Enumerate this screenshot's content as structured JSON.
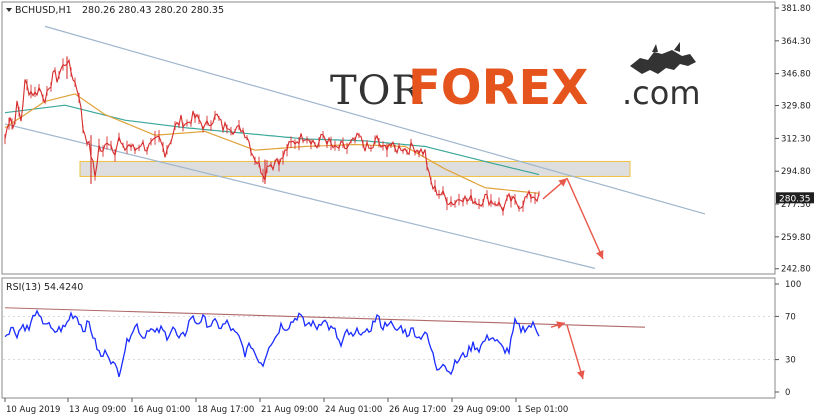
{
  "header": {
    "symbol": "BCHUSD,H1",
    "ohlc": "280.26 280.43 280.20 280.35"
  },
  "logo": {
    "prefix": "TOR",
    "main": "FOREX",
    "suffix": ".com"
  },
  "colors": {
    "candle": "#d62c2c",
    "ma_fast": "#e0a23a",
    "ma_slow": "#3aa79a",
    "channel": "#9fb6cc",
    "zone_fill": "#d8d8d8",
    "zone_border": "#f0c040",
    "arrow": "#e8584a",
    "rsi": "#1a2cff",
    "rsi_trend": "#b06a6a",
    "logo_dark": "#333333",
    "logo_accent": "#e6541e"
  },
  "chart_data": [
    {
      "type": "line",
      "title": "",
      "current_price_label": "280.35",
      "price_ticks": [
        "381.80",
        "364.30",
        "346.80",
        "329.80",
        "312.30",
        "294.80",
        "277.30",
        "259.80",
        "242.80"
      ],
      "price_tick_values": [
        381.8,
        364.3,
        346.8,
        329.8,
        312.3,
        294.8,
        277.3,
        259.8,
        242.8
      ],
      "ylim": [
        240,
        385
      ],
      "x_labels": [
        "10 Aug 2019",
        "13 Aug 09:00",
        "16 Aug 01:00",
        "18 Aug 17:00",
        "21 Aug 09:00",
        "24 Aug 01:00",
        "26 Aug 17:00",
        "29 Aug 09:00",
        "1 Sep 01:00"
      ],
      "x_label_index": [
        0,
        63,
        127,
        191,
        255,
        319,
        383,
        447,
        511
      ],
      "close_series": [
        {
          "i": 0,
          "v": 312
        },
        {
          "i": 5,
          "v": 325
        },
        {
          "i": 8,
          "v": 318
        },
        {
          "i": 12,
          "v": 330
        },
        {
          "i": 16,
          "v": 322
        },
        {
          "i": 20,
          "v": 342
        },
        {
          "i": 24,
          "v": 338
        },
        {
          "i": 30,
          "v": 336
        },
        {
          "i": 34,
          "v": 339
        },
        {
          "i": 40,
          "v": 334
        },
        {
          "i": 44,
          "v": 336
        },
        {
          "i": 48,
          "v": 348
        },
        {
          "i": 52,
          "v": 344
        },
        {
          "i": 56,
          "v": 349
        },
        {
          "i": 62,
          "v": 354
        },
        {
          "i": 66,
          "v": 348
        },
        {
          "i": 70,
          "v": 342
        },
        {
          "i": 74,
          "v": 336
        },
        {
          "i": 78,
          "v": 318
        },
        {
          "i": 82,
          "v": 312
        },
        {
          "i": 86,
          "v": 304
        },
        {
          "i": 90,
          "v": 292
        },
        {
          "i": 94,
          "v": 308
        },
        {
          "i": 98,
          "v": 304
        },
        {
          "i": 102,
          "v": 312
        },
        {
          "i": 106,
          "v": 309
        },
        {
          "i": 110,
          "v": 306
        },
        {
          "i": 114,
          "v": 312
        },
        {
          "i": 118,
          "v": 306
        },
        {
          "i": 124,
          "v": 309
        },
        {
          "i": 130,
          "v": 306
        },
        {
          "i": 136,
          "v": 310
        },
        {
          "i": 142,
          "v": 307
        },
        {
          "i": 148,
          "v": 309
        },
        {
          "i": 154,
          "v": 312
        },
        {
          "i": 160,
          "v": 305
        },
        {
          "i": 166,
          "v": 312
        },
        {
          "i": 170,
          "v": 318
        },
        {
          "i": 176,
          "v": 322
        },
        {
          "i": 182,
          "v": 320
        },
        {
          "i": 188,
          "v": 324
        },
        {
          "i": 194,
          "v": 322
        },
        {
          "i": 200,
          "v": 318
        },
        {
          "i": 206,
          "v": 322
        },
        {
          "i": 212,
          "v": 324
        },
        {
          "i": 218,
          "v": 318
        },
        {
          "i": 224,
          "v": 320
        },
        {
          "i": 230,
          "v": 316
        },
        {
          "i": 236,
          "v": 318
        },
        {
          "i": 242,
          "v": 314
        },
        {
          "i": 248,
          "v": 304
        },
        {
          "i": 252,
          "v": 300
        },
        {
          "i": 256,
          "v": 296
        },
        {
          "i": 260,
          "v": 293
        },
        {
          "i": 264,
          "v": 300
        },
        {
          "i": 268,
          "v": 298
        },
        {
          "i": 272,
          "v": 302
        },
        {
          "i": 276,
          "v": 300
        },
        {
          "i": 282,
          "v": 307
        },
        {
          "i": 288,
          "v": 310
        },
        {
          "i": 294,
          "v": 312
        },
        {
          "i": 300,
          "v": 314
        },
        {
          "i": 306,
          "v": 312
        },
        {
          "i": 312,
          "v": 308
        },
        {
          "i": 318,
          "v": 314
        },
        {
          "i": 324,
          "v": 310
        },
        {
          "i": 330,
          "v": 306
        },
        {
          "i": 336,
          "v": 308
        },
        {
          "i": 342,
          "v": 307
        },
        {
          "i": 348,
          "v": 310
        },
        {
          "i": 354,
          "v": 313
        },
        {
          "i": 360,
          "v": 308
        },
        {
          "i": 366,
          "v": 306
        },
        {
          "i": 372,
          "v": 312
        },
        {
          "i": 378,
          "v": 306
        },
        {
          "i": 384,
          "v": 310
        },
        {
          "i": 390,
          "v": 306
        },
        {
          "i": 396,
          "v": 308
        },
        {
          "i": 402,
          "v": 306
        },
        {
          "i": 408,
          "v": 308
        },
        {
          "i": 414,
          "v": 306
        },
        {
          "i": 420,
          "v": 305
        },
        {
          "i": 424,
          "v": 292
        },
        {
          "i": 428,
          "v": 286
        },
        {
          "i": 432,
          "v": 284
        },
        {
          "i": 438,
          "v": 282
        },
        {
          "i": 444,
          "v": 279
        },
        {
          "i": 450,
          "v": 278
        },
        {
          "i": 456,
          "v": 282
        },
        {
          "i": 462,
          "v": 279
        },
        {
          "i": 468,
          "v": 280
        },
        {
          "i": 474,
          "v": 278
        },
        {
          "i": 480,
          "v": 281
        },
        {
          "i": 486,
          "v": 279
        },
        {
          "i": 492,
          "v": 278
        },
        {
          "i": 498,
          "v": 275
        },
        {
          "i": 504,
          "v": 280
        },
        {
          "i": 510,
          "v": 278
        },
        {
          "i": 516,
          "v": 277
        },
        {
          "i": 522,
          "v": 281
        },
        {
          "i": 528,
          "v": 282
        },
        {
          "i": 534,
          "v": 280.35
        }
      ],
      "spikes": [
        {
          "i": 86,
          "low": 288,
          "high": 314
        },
        {
          "i": 62,
          "low": 344,
          "high": 356
        },
        {
          "i": 260,
          "low": 288,
          "high": 301
        }
      ],
      "ma_fast": [
        {
          "i": 0,
          "v": 318
        },
        {
          "i": 40,
          "v": 332
        },
        {
          "i": 70,
          "v": 336
        },
        {
          "i": 100,
          "v": 325
        },
        {
          "i": 150,
          "v": 314
        },
        {
          "i": 200,
          "v": 316
        },
        {
          "i": 250,
          "v": 306
        },
        {
          "i": 300,
          "v": 308
        },
        {
          "i": 350,
          "v": 309
        },
        {
          "i": 400,
          "v": 308
        },
        {
          "i": 440,
          "v": 296
        },
        {
          "i": 480,
          "v": 286
        },
        {
          "i": 534,
          "v": 283
        }
      ],
      "ma_slow": [
        {
          "i": 0,
          "v": 326
        },
        {
          "i": 60,
          "v": 330
        },
        {
          "i": 120,
          "v": 322
        },
        {
          "i": 180,
          "v": 318
        },
        {
          "i": 240,
          "v": 315
        },
        {
          "i": 300,
          "v": 312
        },
        {
          "i": 360,
          "v": 311
        },
        {
          "i": 420,
          "v": 308
        },
        {
          "i": 480,
          "v": 300
        },
        {
          "i": 534,
          "v": 293
        }
      ],
      "channel_upper": [
        {
          "i": 40,
          "v": 372
        },
        {
          "i": 700,
          "v": 272
        }
      ],
      "channel_lower": [
        {
          "i": 0,
          "v": 320
        },
        {
          "i": 590,
          "v": 243
        }
      ],
      "resistance_zone": {
        "from_i": 75,
        "to_i": 625,
        "top": 300,
        "bottom": 292
      },
      "forecast_arrows": [
        {
          "from_i": 538,
          "from_v": 280,
          "to_i": 562,
          "to_v": 291
        },
        {
          "from_i": 562,
          "from_v": 291,
          "to_i": 598,
          "to_v": 248
        }
      ]
    },
    {
      "type": "line",
      "title": "RSI(13) 54.4240",
      "ticks": [
        "100",
        "70",
        "30",
        "0"
      ],
      "tick_values": [
        100,
        70,
        30,
        0
      ],
      "ylim": [
        0,
        100
      ],
      "values": [
        {
          "i": 0,
          "v": 52
        },
        {
          "i": 6,
          "v": 60
        },
        {
          "i": 12,
          "v": 54
        },
        {
          "i": 18,
          "v": 62
        },
        {
          "i": 24,
          "v": 58
        },
        {
          "i": 30,
          "v": 74
        },
        {
          "i": 36,
          "v": 66
        },
        {
          "i": 42,
          "v": 64
        },
        {
          "i": 48,
          "v": 55
        },
        {
          "i": 54,
          "v": 58
        },
        {
          "i": 60,
          "v": 60
        },
        {
          "i": 66,
          "v": 72
        },
        {
          "i": 72,
          "v": 70
        },
        {
          "i": 78,
          "v": 58
        },
        {
          "i": 84,
          "v": 64
        },
        {
          "i": 90,
          "v": 46
        },
        {
          "i": 96,
          "v": 32
        },
        {
          "i": 102,
          "v": 38
        },
        {
          "i": 108,
          "v": 26
        },
        {
          "i": 114,
          "v": 18
        },
        {
          "i": 120,
          "v": 40
        },
        {
          "i": 126,
          "v": 56
        },
        {
          "i": 132,
          "v": 62
        },
        {
          "i": 138,
          "v": 50
        },
        {
          "i": 144,
          "v": 60
        },
        {
          "i": 150,
          "v": 54
        },
        {
          "i": 156,
          "v": 58
        },
        {
          "i": 162,
          "v": 52
        },
        {
          "i": 168,
          "v": 60
        },
        {
          "i": 174,
          "v": 48
        },
        {
          "i": 180,
          "v": 54
        },
        {
          "i": 186,
          "v": 70
        },
        {
          "i": 192,
          "v": 64
        },
        {
          "i": 198,
          "v": 68
        },
        {
          "i": 204,
          "v": 62
        },
        {
          "i": 210,
          "v": 64
        },
        {
          "i": 216,
          "v": 60
        },
        {
          "i": 222,
          "v": 64
        },
        {
          "i": 228,
          "v": 56
        },
        {
          "i": 234,
          "v": 50
        },
        {
          "i": 240,
          "v": 36
        },
        {
          "i": 246,
          "v": 44
        },
        {
          "i": 252,
          "v": 32
        },
        {
          "i": 258,
          "v": 26
        },
        {
          "i": 264,
          "v": 44
        },
        {
          "i": 270,
          "v": 50
        },
        {
          "i": 276,
          "v": 62
        },
        {
          "i": 282,
          "v": 60
        },
        {
          "i": 288,
          "v": 66
        },
        {
          "i": 294,
          "v": 72
        },
        {
          "i": 300,
          "v": 62
        },
        {
          "i": 306,
          "v": 64
        },
        {
          "i": 312,
          "v": 60
        },
        {
          "i": 318,
          "v": 68
        },
        {
          "i": 324,
          "v": 60
        },
        {
          "i": 330,
          "v": 56
        },
        {
          "i": 336,
          "v": 42
        },
        {
          "i": 342,
          "v": 56
        },
        {
          "i": 348,
          "v": 50
        },
        {
          "i": 354,
          "v": 58
        },
        {
          "i": 360,
          "v": 52
        },
        {
          "i": 366,
          "v": 60
        },
        {
          "i": 372,
          "v": 70
        },
        {
          "i": 378,
          "v": 60
        },
        {
          "i": 384,
          "v": 66
        },
        {
          "i": 390,
          "v": 56
        },
        {
          "i": 396,
          "v": 60
        },
        {
          "i": 402,
          "v": 54
        },
        {
          "i": 408,
          "v": 58
        },
        {
          "i": 414,
          "v": 50
        },
        {
          "i": 420,
          "v": 56
        },
        {
          "i": 426,
          "v": 40
        },
        {
          "i": 432,
          "v": 22
        },
        {
          "i": 438,
          "v": 28
        },
        {
          "i": 444,
          "v": 18
        },
        {
          "i": 450,
          "v": 26
        },
        {
          "i": 456,
          "v": 32
        },
        {
          "i": 462,
          "v": 36
        },
        {
          "i": 468,
          "v": 44
        },
        {
          "i": 474,
          "v": 40
        },
        {
          "i": 480,
          "v": 48
        },
        {
          "i": 486,
          "v": 52
        },
        {
          "i": 492,
          "v": 46
        },
        {
          "i": 498,
          "v": 40
        },
        {
          "i": 504,
          "v": 38
        },
        {
          "i": 510,
          "v": 64
        },
        {
          "i": 516,
          "v": 58
        },
        {
          "i": 522,
          "v": 60
        },
        {
          "i": 528,
          "v": 62
        },
        {
          "i": 534,
          "v": 54.424
        }
      ],
      "trend_line": [
        {
          "i": 0,
          "v": 78
        },
        {
          "i": 640,
          "v": 60
        }
      ],
      "forecast_arrows": [
        {
          "from_i": 546,
          "from_v": 60,
          "to_i": 560,
          "to_v": 64
        },
        {
          "from_i": 562,
          "from_v": 62,
          "to_i": 578,
          "to_v": 12
        }
      ]
    }
  ]
}
